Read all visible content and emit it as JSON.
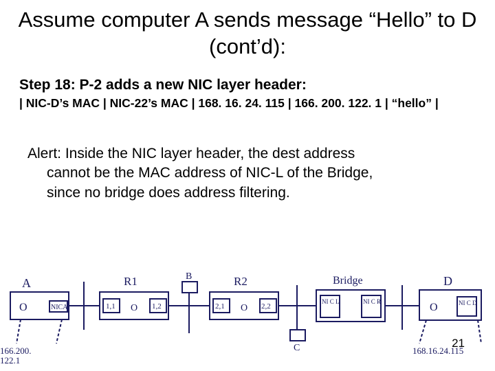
{
  "title": "Assume computer A sends message “Hello” to D (cont’d):",
  "step_line": "Step 18: P-2 adds a new NIC layer header:",
  "fields_line": "| NIC-D’s MAC | NIC-22’s MAC | 168. 16. 24. 115 | 166. 200. 122. 1 | “hello” |",
  "alert": {
    "l1": "Alert: Inside the NIC layer header, the dest address",
    "l2": "cannot be the MAC address of NIC-L of the Bridge,",
    "l3": "since no bridge does address filtering."
  },
  "page_number": "21",
  "diagram": {
    "labels": {
      "A": "A",
      "R1": "R1",
      "B": "B",
      "R2": "R2",
      "Bridge": "Bridge",
      "C": "C",
      "D": "D",
      "nodeA_O": "O",
      "nodeA_nic": "NICA",
      "R1_11": "1,1",
      "R1_O": "O",
      "R1_12": "1,2",
      "R2_21": "2,1",
      "R2_O": "O",
      "R2_22": "2,2",
      "br_nicL": "NI C L",
      "br_nicR": "NI C R",
      "D_O": "O",
      "D_nic": "NI C D",
      "ip_left": "166.200.\n122.1",
      "ip_right": "168.16.24.115"
    }
  }
}
